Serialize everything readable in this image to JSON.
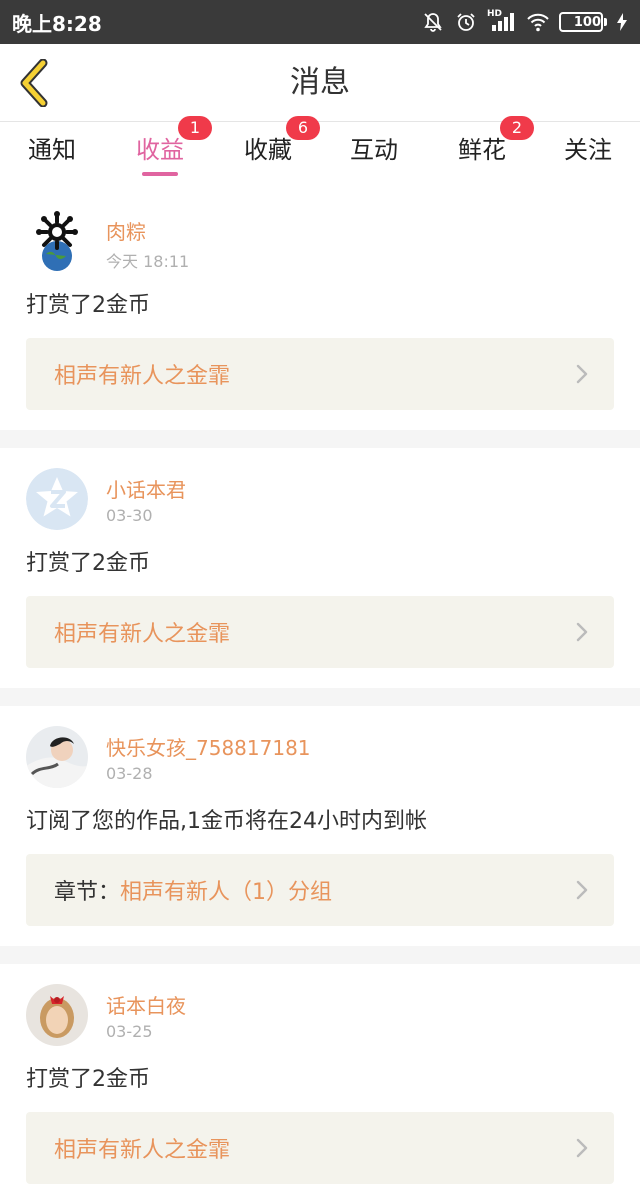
{
  "status_bar": {
    "time": "晚上8:28",
    "battery": "100",
    "battery_level": 1.0,
    "signal_label": "HD"
  },
  "header": {
    "title": "消息"
  },
  "tabs": [
    {
      "label": "通知",
      "badge": ""
    },
    {
      "label": "收益",
      "badge": "1",
      "active": true
    },
    {
      "label": "收藏",
      "badge": "6"
    },
    {
      "label": "互动",
      "badge": ""
    },
    {
      "label": "鲜花",
      "badge": "2"
    },
    {
      "label": "关注",
      "badge": ""
    }
  ],
  "feed": [
    {
      "username": "肉粽",
      "time": "今天 18:11",
      "text": "打赏了2金币",
      "link_prefix": "",
      "link_text": "相声有新人之金霏"
    },
    {
      "username": "小话本君",
      "time": "03-30",
      "text": "打赏了2金币",
      "link_prefix": "",
      "link_text": "相声有新人之金霏"
    },
    {
      "username": "快乐女孩_758817181",
      "time": "03-28",
      "text": "订阅了您的作品,1金币将在24小时内到帐",
      "link_prefix": "章节：",
      "link_text": "相声有新人（1）分组"
    },
    {
      "username": "话本白夜",
      "time": "03-25",
      "text": "打赏了2金币",
      "link_prefix": "",
      "link_text": "相声有新人之金霏"
    }
  ],
  "colors": {
    "accent": "#e064a0",
    "badge": "#f03a4a",
    "username": "#e8945c",
    "link_bg": "#f4f3ec",
    "status_bar": "#3a3a3a"
  }
}
